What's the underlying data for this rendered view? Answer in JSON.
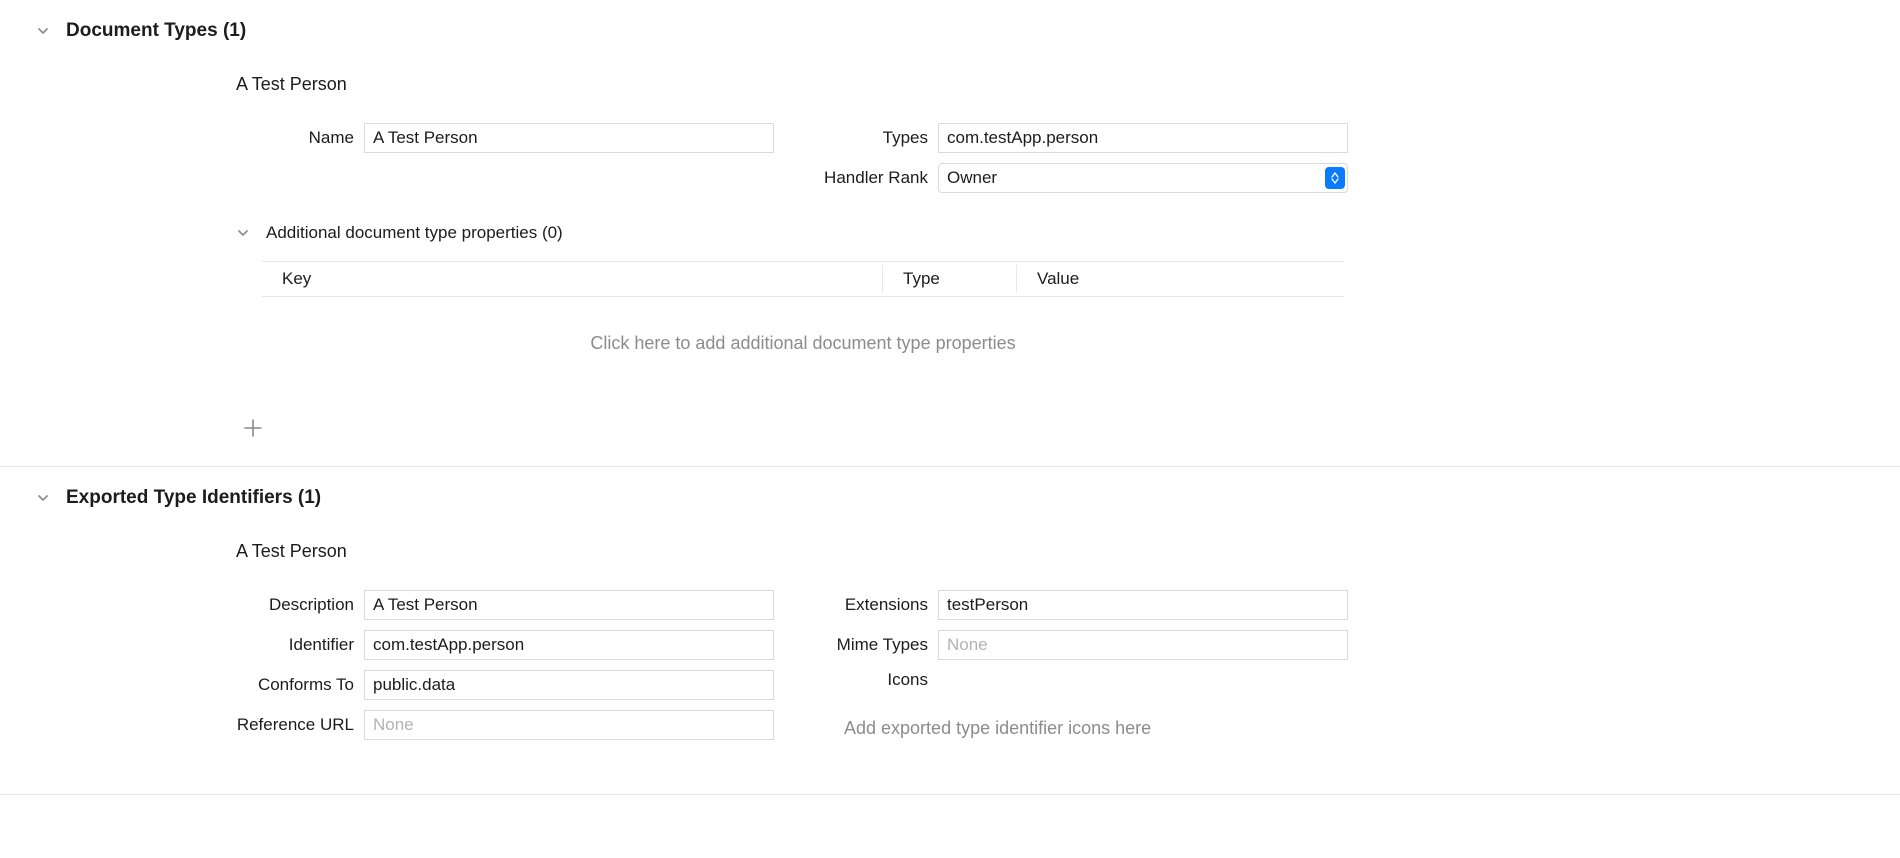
{
  "documentTypes": {
    "header": "Document Types (1)",
    "itemTitle": "A Test Person",
    "labels": {
      "name": "Name",
      "types": "Types",
      "handlerRank": "Handler Rank"
    },
    "values": {
      "name": "A Test Person",
      "types": "com.testApp.person",
      "handlerRank": "Owner"
    },
    "additional": {
      "header": "Additional document type properties (0)",
      "columns": {
        "key": "Key",
        "type": "Type",
        "value": "Value"
      },
      "emptyHint": "Click here to add additional document type properties"
    }
  },
  "exportedTypes": {
    "header": "Exported Type Identifiers (1)",
    "itemTitle": "A Test Person",
    "labels": {
      "description": "Description",
      "identifier": "Identifier",
      "conformsTo": "Conforms To",
      "referenceURL": "Reference URL",
      "extensions": "Extensions",
      "mimeTypes": "Mime Types",
      "icons": "Icons"
    },
    "values": {
      "description": "A Test Person",
      "identifier": "com.testApp.person",
      "conformsTo": "public.data",
      "referenceURL": "",
      "extensions": "testPerson",
      "mimeTypes": ""
    },
    "placeholders": {
      "none": "None"
    },
    "iconsHint": "Add exported type identifier icons here"
  }
}
